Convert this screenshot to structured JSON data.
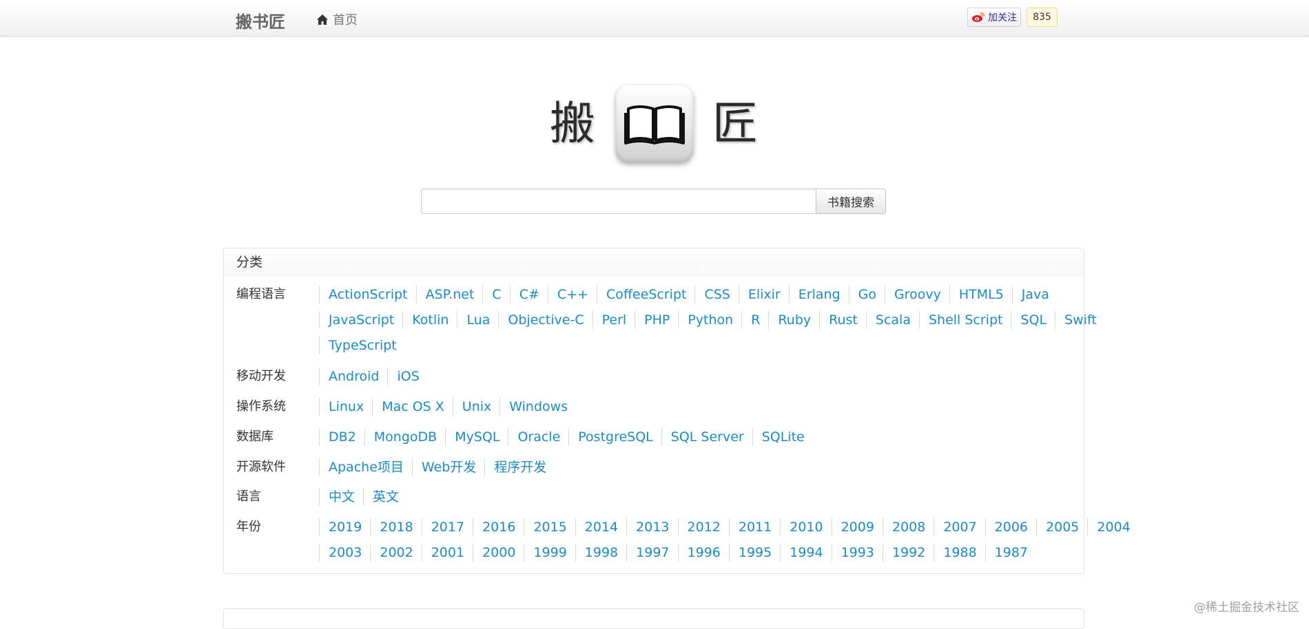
{
  "navbar": {
    "brand": "搬书匠",
    "home_label": "首页",
    "weibo_follow_label": "加关注",
    "weibo_count": "835"
  },
  "logo": {
    "char_left": "搬",
    "char_right": "匠",
    "icon": "open-book-icon"
  },
  "search": {
    "input_value": "",
    "button_label": "书籍搜索"
  },
  "categories": {
    "title": "分类",
    "rows": [
      {
        "label": "编程语言",
        "lines": [
          [
            "ActionScript",
            "ASP.net",
            "C",
            "C#",
            "C++",
            "CoffeeScript",
            "CSS",
            "Elixir",
            "Erlang",
            "Go",
            "Groovy",
            "HTML5",
            "Java"
          ],
          [
            "JavaScript",
            "Kotlin",
            "Lua",
            "Objective-C",
            "Perl",
            "PHP",
            "Python",
            "R",
            "Ruby",
            "Rust",
            "Scala",
            "Shell Script",
            "SQL",
            "Swift"
          ],
          [
            "TypeScript"
          ]
        ]
      },
      {
        "label": "移动开发",
        "lines": [
          [
            "Android",
            "iOS"
          ]
        ]
      },
      {
        "label": "操作系统",
        "lines": [
          [
            "Linux",
            "Mac OS X",
            "Unix",
            "Windows"
          ]
        ]
      },
      {
        "label": "数据库",
        "lines": [
          [
            "DB2",
            "MongoDB",
            "MySQL",
            "Oracle",
            "PostgreSQL",
            "SQL Server",
            "SQLite"
          ]
        ]
      },
      {
        "label": "开源软件",
        "lines": [
          [
            "Apache项目",
            "Web开发",
            "程序开发"
          ]
        ]
      },
      {
        "label": "语言",
        "lines": [
          [
            "中文",
            "英文"
          ]
        ]
      },
      {
        "label": "年份",
        "lines": [
          [
            "2019",
            "2018",
            "2017",
            "2016",
            "2015",
            "2014",
            "2013",
            "2012",
            "2011",
            "2010",
            "2009",
            "2008",
            "2007",
            "2006",
            "2005",
            "2004"
          ],
          [
            "2003",
            "2002",
            "2001",
            "2000",
            "1999",
            "1998",
            "1997",
            "1996",
            "1995",
            "1994",
            "1993",
            "1992",
            "1988",
            "1987"
          ]
        ]
      }
    ]
  },
  "watermark": "@稀土掘金技术社区",
  "colors": {
    "link": "#1a8bc4",
    "brand_text": "#666666",
    "weibo_count_bg": "#fff9e0"
  }
}
